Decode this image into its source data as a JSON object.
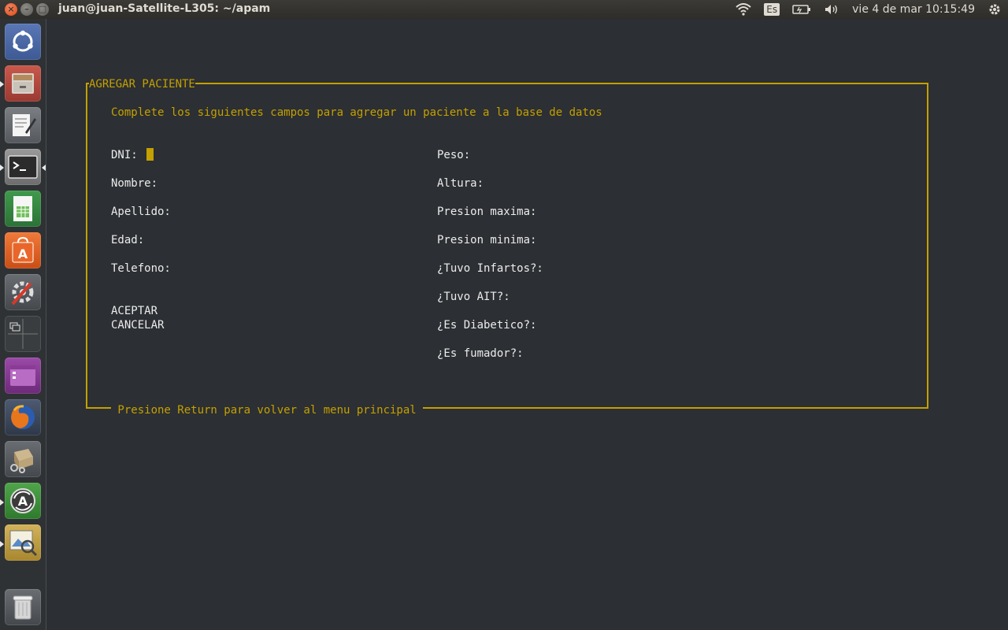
{
  "window": {
    "title": "juan@juan-Satellite-L305: ~/apam",
    "buttons": {
      "close": "×",
      "minimize": "–",
      "maximize": "□"
    }
  },
  "indicators": {
    "wifi_icon": "wifi-icon",
    "keyboard_layout": "Es",
    "battery_icon": "battery-icon",
    "volume_icon": "volume-icon",
    "clock": "vie  4 de mar 10:15:49",
    "gear_icon": "gear-icon"
  },
  "launcher": {
    "items": [
      {
        "name": "ubuntu-dash-icon",
        "glyph": "◎"
      },
      {
        "name": "files-icon",
        "glyph": "▭"
      },
      {
        "name": "text-editor-icon",
        "glyph": "✎"
      },
      {
        "name": "terminal-icon",
        "glyph": ">_"
      },
      {
        "name": "spreadsheet-icon",
        "glyph": "▦"
      },
      {
        "name": "software-center-icon",
        "glyph": "A"
      },
      {
        "name": "system-settings-icon",
        "glyph": "⚙"
      },
      {
        "name": "workspace-switcher-icon",
        "glyph": "⊞"
      },
      {
        "name": "app-window-icon",
        "glyph": "▤"
      },
      {
        "name": "firefox-icon",
        "glyph": "●"
      },
      {
        "name": "package-installer-icon",
        "glyph": "▣"
      },
      {
        "name": "software-updater-icon",
        "glyph": "A"
      },
      {
        "name": "image-viewer-icon",
        "glyph": "⌕"
      },
      {
        "name": "trash-icon",
        "glyph": "🗑"
      }
    ]
  },
  "form": {
    "frame_title": "AGREGAR PACIENTE",
    "instructions": "Complete los siguientes campos para agregar un paciente a la base de datos",
    "left_fields": [
      "DNI:",
      "Nombre:",
      "Apellido:",
      "Edad:",
      "Telefono:"
    ],
    "right_fields": [
      "Peso:",
      "Altura:",
      "Presion maxima:",
      "Presion minima:",
      "¿Tuvo Infartos?:",
      "¿Tuvo AIT?:",
      "¿Es Diabetico?:",
      "¿Es fumador?:"
    ],
    "accept_label": "ACEPTAR",
    "cancel_label": "CANCELAR",
    "footer": " Presione Return para volver al menu principal "
  },
  "colors": {
    "accent": "#c4a000",
    "terminal_bg": "#2c2f33",
    "text": "#ececec"
  }
}
